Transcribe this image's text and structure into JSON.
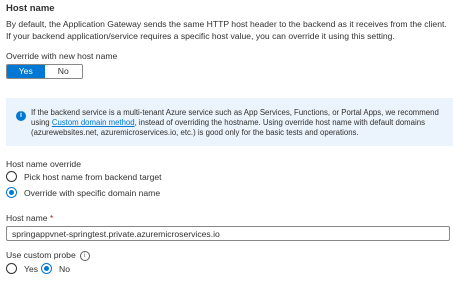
{
  "section": {
    "title": "Host name",
    "description": "By default, the Application Gateway sends the same HTTP host header to the backend as it receives from the client. If your backend application/service requires a specific host value, you can override it using this setting."
  },
  "override": {
    "label": "Override with new host name",
    "options": [
      "Yes",
      "No"
    ],
    "selected": "Yes"
  },
  "info": {
    "text_before": "If the backend service is a multi-tenant Azure service such as App Services, Functions, or Portal Apps, we recommend using ",
    "link": "Custom domain method",
    "text_after": ", instead of overriding the hostname. Using override host name with default domains (azurewebsites.net, azuremicroservices.io, etc.) is good only for the basic tests and operations."
  },
  "host_name_override": {
    "label": "Host name override",
    "options": [
      "Pick host name from backend target",
      "Override with specific domain name"
    ],
    "selected": "Override with specific domain name"
  },
  "host_name": {
    "label": "Host name",
    "required_mark": "*",
    "value": "springappvnet-springtest.private.azuremicroservices.io"
  },
  "custom_probe": {
    "label": "Use custom probe",
    "help": "i",
    "options": [
      "Yes",
      "No"
    ],
    "selected": "No"
  },
  "colors": {
    "accent": "#0078d4",
    "info_background": "#ebf3fc",
    "text": "#323130"
  }
}
